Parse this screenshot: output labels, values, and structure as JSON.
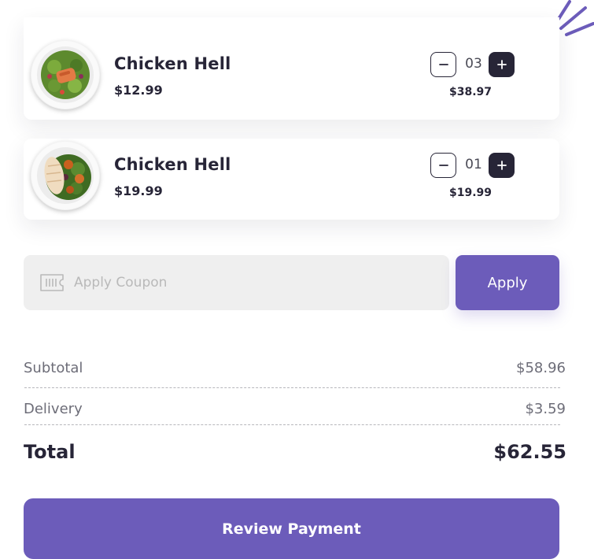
{
  "cart": {
    "items": [
      {
        "name": "Chicken Hell",
        "price": "$12.99",
        "quantity": "03",
        "line_total": "$38.97",
        "image": "salmon-salad-plate"
      },
      {
        "name": "Chicken Hell",
        "price": "$19.99",
        "quantity": "01",
        "line_total": "$19.99",
        "image": "chicken-greens-plate"
      }
    ]
  },
  "coupon": {
    "placeholder": "Apply Coupon",
    "icon": "ticket-icon",
    "apply_label": "Apply"
  },
  "summary": {
    "subtotal_label": "Subtotal",
    "subtotal_value": "$58.96",
    "delivery_label": "Delivery",
    "delivery_value": "$3.59",
    "total_label": "Total",
    "total_value": "$62.55"
  },
  "checkout": {
    "review_label": "Review Payment"
  },
  "colors": {
    "accent": "#6c5cba",
    "dark": "#272537",
    "muted": "#6d6d78",
    "input_bg": "#efefef"
  }
}
